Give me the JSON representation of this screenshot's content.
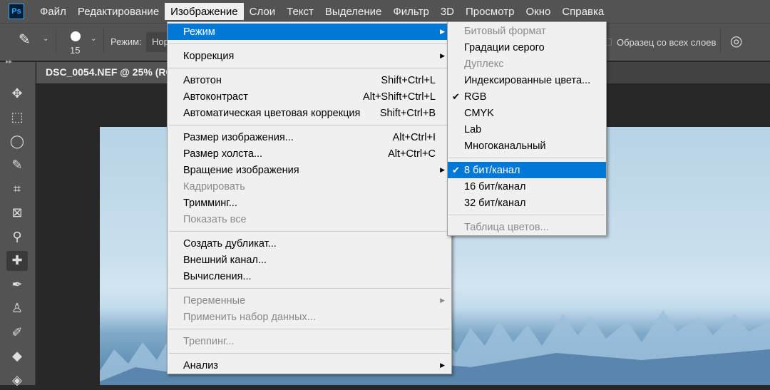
{
  "app": {
    "logo": "Ps"
  },
  "menubar": [
    "Файл",
    "Редактирование",
    "Изображение",
    "Слои",
    "Текст",
    "Выделение",
    "Фильтр",
    "3D",
    "Просмотр",
    "Окно",
    "Справка"
  ],
  "options": {
    "brush_size": "15",
    "mode_label": "Режим:",
    "mode_value": "Нор",
    "sample_all": "Образец со всех слоев"
  },
  "document": {
    "tab": "DSC_0054.NEF @ 25% (RGB/8)"
  },
  "image_menu": [
    {
      "label": "Режим",
      "arrow": true,
      "hi": true
    },
    {
      "sep": true
    },
    {
      "label": "Коррекция",
      "arrow": true
    },
    {
      "sep": true
    },
    {
      "label": "Автотон",
      "sc": "Shift+Ctrl+L"
    },
    {
      "label": "Автоконтраст",
      "sc": "Alt+Shift+Ctrl+L"
    },
    {
      "label": "Автоматическая цветовая коррекция",
      "sc": "Shift+Ctrl+B"
    },
    {
      "sep": true
    },
    {
      "label": "Размер изображения...",
      "sc": "Alt+Ctrl+I"
    },
    {
      "label": "Размер холста...",
      "sc": "Alt+Ctrl+C"
    },
    {
      "label": "Вращение изображения",
      "arrow": true
    },
    {
      "label": "Кадрировать",
      "dis": true
    },
    {
      "label": "Тримминг..."
    },
    {
      "label": "Показать все",
      "dis": true
    },
    {
      "sep": true
    },
    {
      "label": "Создать дубликат..."
    },
    {
      "label": "Внешний канал..."
    },
    {
      "label": "Вычисления..."
    },
    {
      "sep": true
    },
    {
      "label": "Переменные",
      "arrow": true,
      "dis": true
    },
    {
      "label": "Применить набор данных...",
      "dis": true
    },
    {
      "sep": true
    },
    {
      "label": "Треппинг...",
      "dis": true
    },
    {
      "sep": true
    },
    {
      "label": "Анализ",
      "arrow": true
    }
  ],
  "mode_submenu": [
    {
      "label": "Битовый формат",
      "dis": true
    },
    {
      "label": "Градации серого"
    },
    {
      "label": "Дуплекс",
      "dis": true
    },
    {
      "label": "Индексированные цвета..."
    },
    {
      "label": "RGB",
      "check": true
    },
    {
      "label": "CMYK"
    },
    {
      "label": "Lab"
    },
    {
      "label": "Многоканальный"
    },
    {
      "sep": true
    },
    {
      "label": "8 бит/канал",
      "check": true,
      "hi": true
    },
    {
      "label": "16 бит/канал"
    },
    {
      "label": "32 бит/канал"
    },
    {
      "sep": true
    },
    {
      "label": "Таблица цветов...",
      "dis": true
    }
  ],
  "tools": [
    "move",
    "marquee",
    "lasso",
    "quick-select",
    "crop",
    "frame",
    "eyedropper",
    "healing-brush",
    "brush",
    "clone-stamp",
    "history-brush",
    "eraser",
    "paint-bucket"
  ]
}
